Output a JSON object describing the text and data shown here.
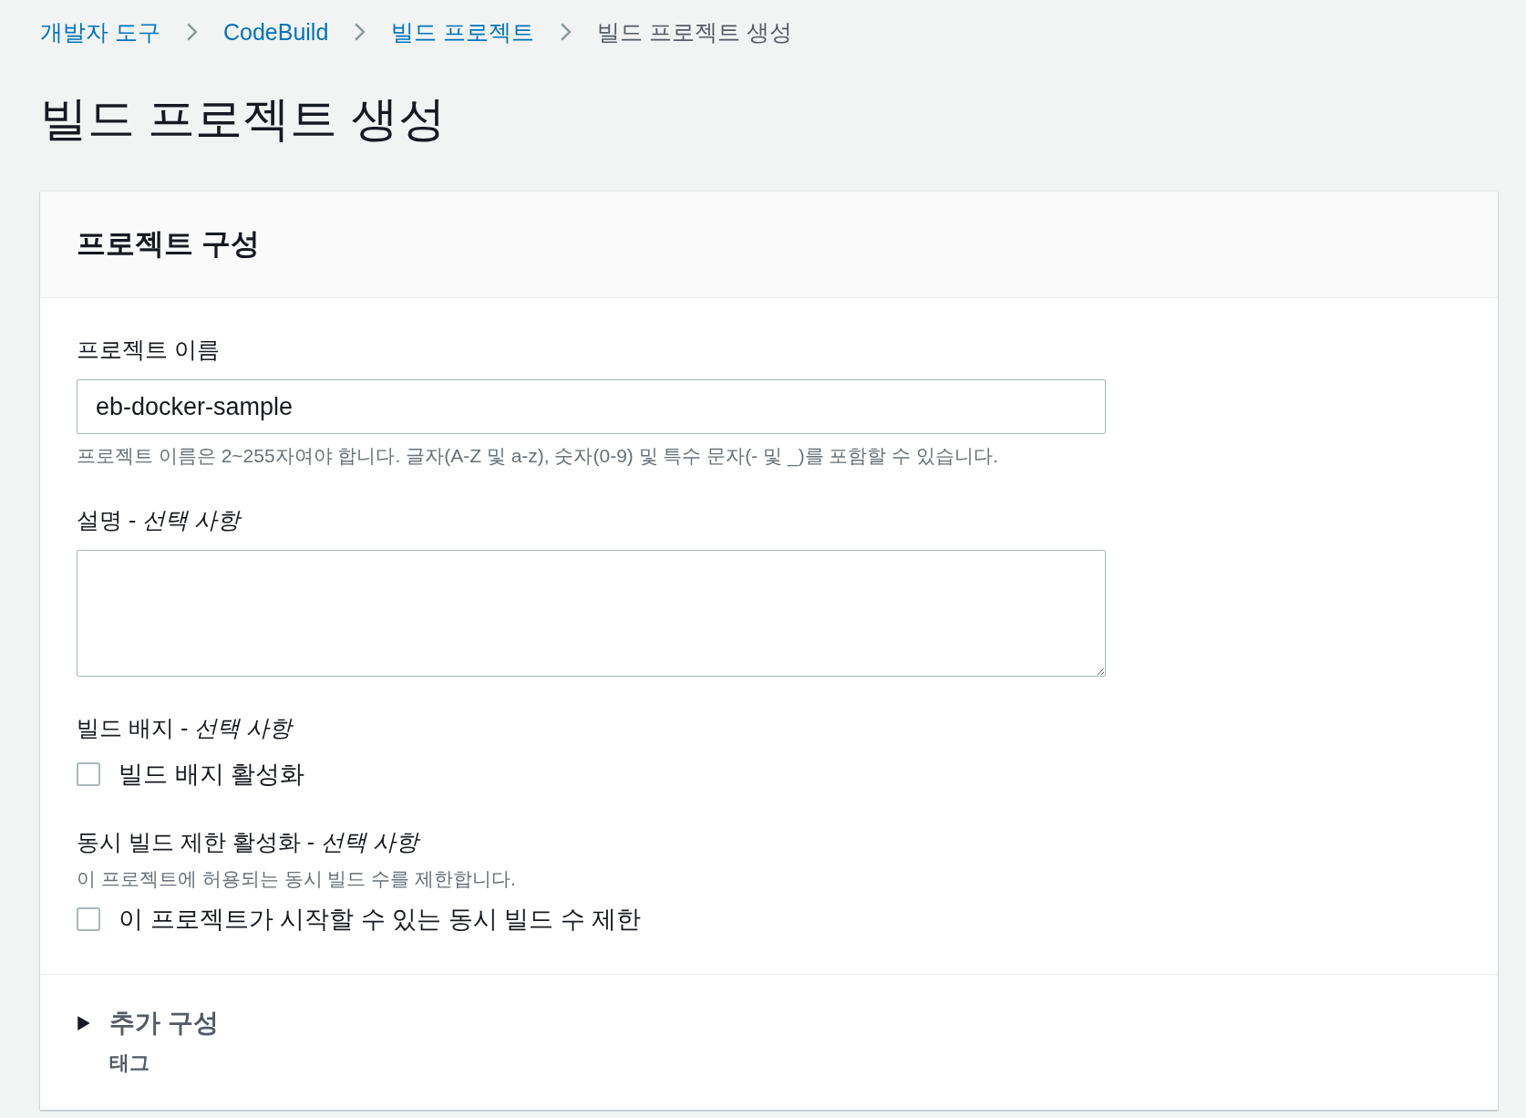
{
  "breadcrumbs": [
    {
      "label": "개발자 도구",
      "link": true
    },
    {
      "label": "CodeBuild",
      "link": true
    },
    {
      "label": "빌드 프로젝트",
      "link": true
    },
    {
      "label": "빌드 프로젝트 생성",
      "link": false
    }
  ],
  "page_title": "빌드 프로젝트 생성",
  "panel": {
    "title": "프로젝트 구성",
    "fields": [
      {
        "kind": "text",
        "label": "프로젝트 이름",
        "value": "eb-docker-sample",
        "hint": "프로젝트 이름은 2~255자여야 합니다. 글자(A-Z 및 a-z), 숫자(0-9) 및 특수 문자(- 및 _)를 포함할 수 있습니다."
      },
      {
        "kind": "textarea",
        "label": "설명 - *선택 사항*"
      },
      {
        "kind": "checkbox",
        "label": "빌드 배지 - *선택 사항*",
        "option": "빌드 배지 활성화",
        "checked": false
      },
      {
        "kind": "checkbox",
        "label": "동시 빌드 제한 활성화 - *선택 사항*",
        "description": "이 프로젝트에 허용되는 동시 빌드 수를 제한합니다.",
        "option": "이 프로젝트가 시작할 수 있는 동시 빌드 수 제한",
        "checked": false
      }
    ],
    "expander": {
      "label": "추가 구성",
      "expanded": false,
      "summary": "태그"
    }
  }
}
